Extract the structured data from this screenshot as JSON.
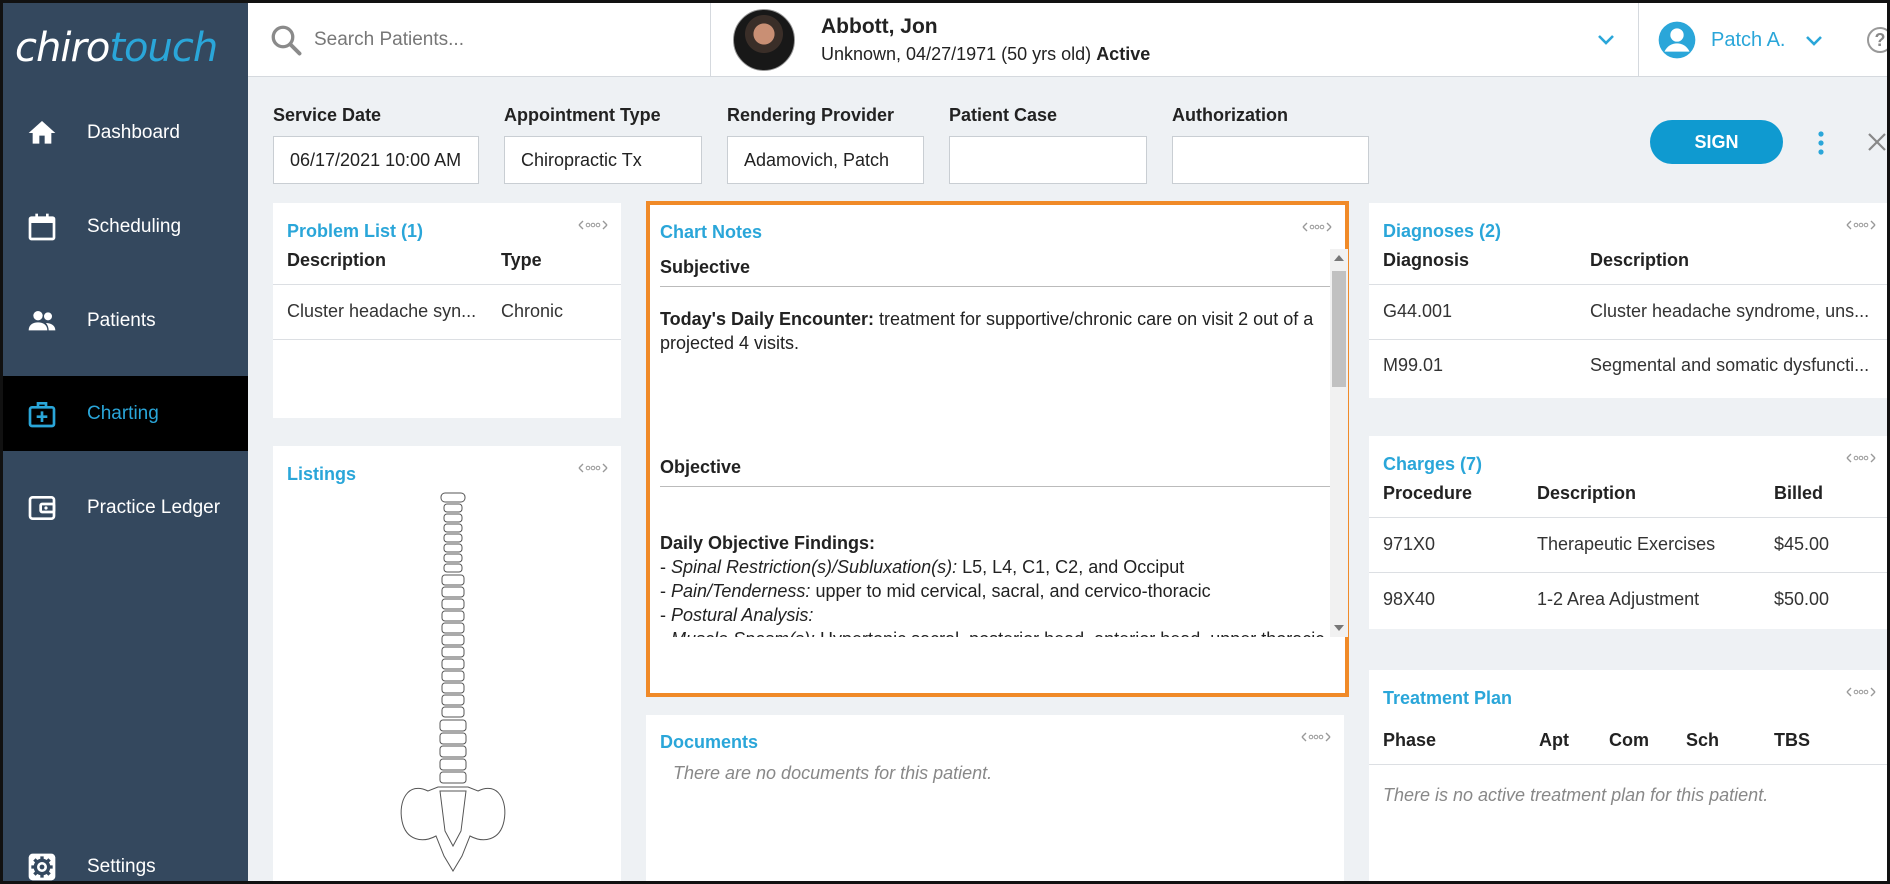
{
  "app": {
    "logo_main": "chiro",
    "logo_accent": "touch"
  },
  "sidebar": {
    "items": [
      {
        "label": "Dashboard",
        "icon": "home-icon"
      },
      {
        "label": "Scheduling",
        "icon": "calendar-icon"
      },
      {
        "label": "Patients",
        "icon": "people-icon"
      },
      {
        "label": "Charting",
        "icon": "medical-bag-icon",
        "active": true
      },
      {
        "label": "Practice Ledger",
        "icon": "wallet-icon"
      },
      {
        "label": "Settings",
        "icon": "gear-icon"
      }
    ]
  },
  "search": {
    "placeholder": "Search Patients..."
  },
  "patient": {
    "name": "Abbott, Jon",
    "info": "Unknown, 04/27/1971 (50 yrs old)",
    "status": "Active"
  },
  "user": {
    "name": "Patch A.",
    "help": "?"
  },
  "form": {
    "service_date_label": "Service Date",
    "service_date_value": "06/17/2021 10:00 AM",
    "appointment_type_label": "Appointment Type",
    "appointment_type_value": "Chiropractic Tx",
    "rendering_provider_label": "Rendering Provider",
    "rendering_provider_value": "Adamovich, Patch",
    "patient_case_label": "Patient Case",
    "patient_case_value": "",
    "authorization_label": "Authorization",
    "authorization_value": "",
    "sign_label": "SIGN"
  },
  "problem_list": {
    "title": "Problem List (1)",
    "headers": [
      "Description",
      "Type"
    ],
    "rows": [
      {
        "description": "Cluster headache syn...",
        "type": "Chronic"
      }
    ]
  },
  "listings": {
    "title": "Listings"
  },
  "chart_notes": {
    "title": "Chart Notes",
    "subjective_heading": "Subjective",
    "encounter_label": "Today's Daily Encounter:",
    "encounter_text": " treatment for supportive/chronic care on visit 2 out of a projected 4 visits.",
    "objective_heading": "Objective",
    "findings_label": "Daily Objective Findings:",
    "findings": [
      {
        "label": "Spinal Restriction(s)/Subluxation(s):",
        "text": " L5, L4, C1, C2, and Occiput"
      },
      {
        "label": "Pain/Tenderness:",
        "text": " upper to mid cervical, sacral, and cervico-thoracic"
      },
      {
        "label": "Postural Analysis:",
        "text": ""
      },
      {
        "label": "Muscle Spasm(s):",
        "text": " Hypertonic sacral, posterior head, anterior head, upper thoracic, mid thoracic, right posterior pelvis/hip, right sacroiliac, left sacroiliac,"
      }
    ]
  },
  "documents": {
    "title": "Documents",
    "empty": "There are no documents for this patient."
  },
  "diagnoses": {
    "title": "Diagnoses (2)",
    "headers": [
      "Diagnosis",
      "Description"
    ],
    "rows": [
      {
        "code": "G44.001",
        "description": "Cluster headache syndrome, uns..."
      },
      {
        "code": "M99.01",
        "description": "Segmental and somatic dysfuncti..."
      }
    ]
  },
  "charges": {
    "title": "Charges (7)",
    "headers": [
      "Procedure",
      "Description",
      "Billed"
    ],
    "rows": [
      {
        "procedure": "971X0",
        "description": "Therapeutic Exercises",
        "billed": "$45.00"
      },
      {
        "procedure": "98X40",
        "description": "1-2 Area Adjustment",
        "billed": "$50.00"
      }
    ]
  },
  "treatment_plan": {
    "title": "Treatment Plan",
    "headers": [
      "Phase",
      "Apt",
      "Com",
      "Sch",
      "TBS"
    ],
    "empty": "There is no active treatment plan for this patient."
  },
  "colors": {
    "sidebar_bg": "#34485e",
    "accent": "#2aa6d9",
    "highlight_border": "#f08a28",
    "sign_button": "#0f9ad0"
  }
}
